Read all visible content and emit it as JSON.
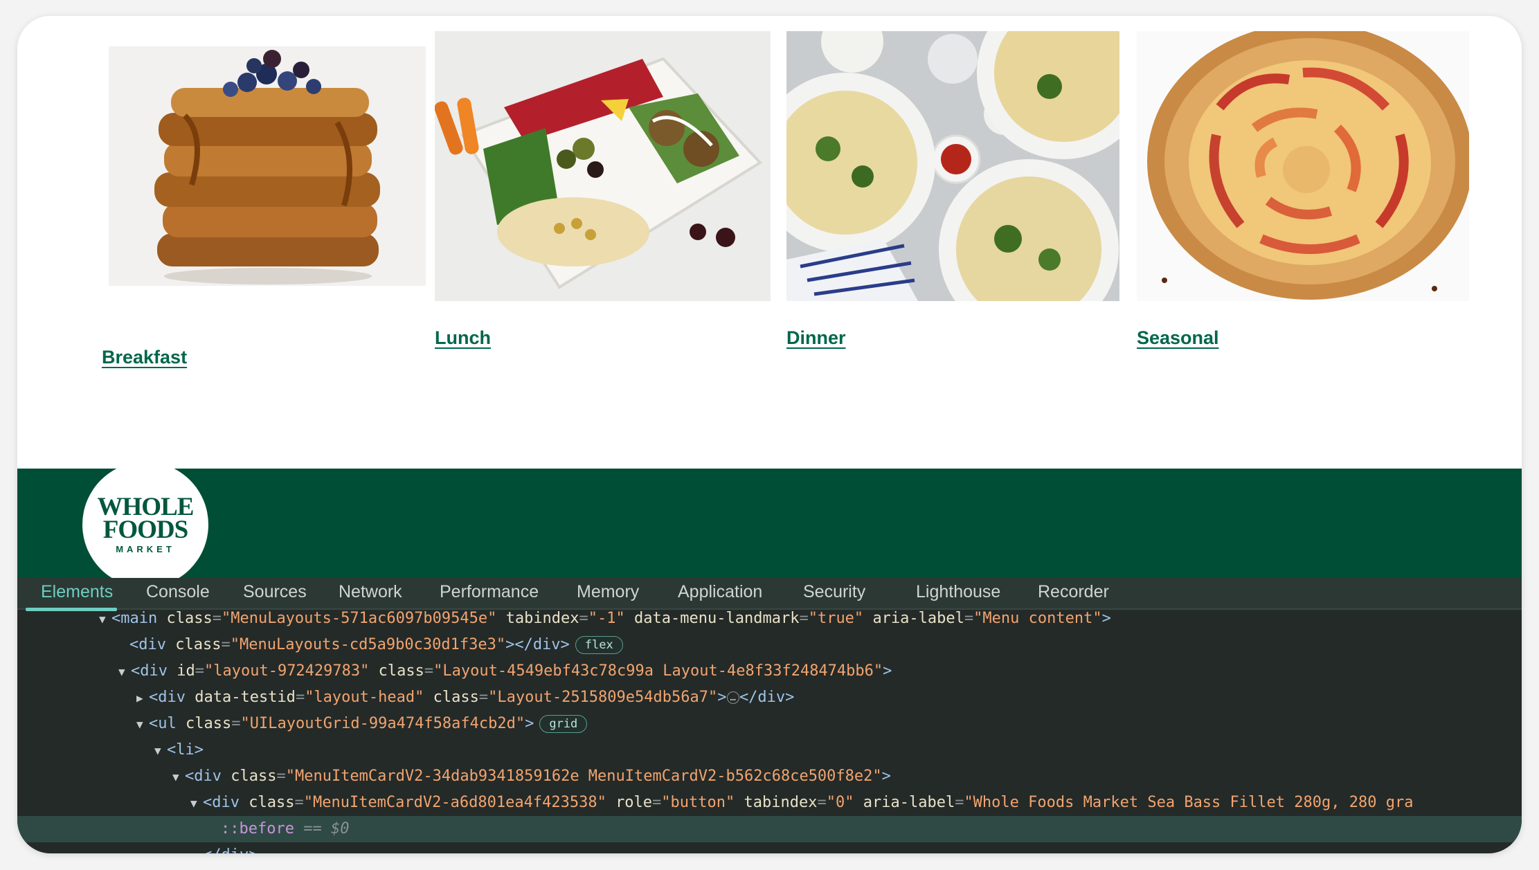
{
  "menu_cards": [
    {
      "label": "Breakfast",
      "image": "french-toast-stack"
    },
    {
      "label": "Lunch",
      "image": "falafel-lunch-tray"
    },
    {
      "label": "Dinner",
      "image": "orecchiette-pasta-bowls"
    },
    {
      "label": "Seasonal",
      "image": "apple-galette"
    }
  ],
  "logo": {
    "line1": "WHOLE",
    "line2": "FOODS",
    "line3": "MARKET"
  },
  "devtools": {
    "tabs": [
      "Elements",
      "Console",
      "Sources",
      "Network",
      "Performance",
      "Memory",
      "Application",
      "Security",
      "Lighthouse",
      "Recorder"
    ],
    "active_tab": "Elements",
    "dom": {
      "l1_tag_open": "<main",
      "l1_a1": "class",
      "l1_v1": "\"MenuLayouts-571ac6097b09545e\"",
      "l1_a2": "tabindex",
      "l1_v2": "\"-1\"",
      "l1_a3": "data-menu-landmark",
      "l1_v3": "\"true\"",
      "l1_a4": "aria-label",
      "l1_v4": "\"Menu content\"",
      "l2_tag_open": "<div",
      "l2_a1": "class",
      "l2_v1": "\"MenuLayouts-cd5a9b0c30d1f3e3\"",
      "l2_close": "></div>",
      "l2_badge": "flex",
      "l3_tag_open": "<div",
      "l3_a1": "id",
      "l3_v1": "\"layout-972429783\"",
      "l3_a2": "class",
      "l3_v2": "\"Layout-4549ebf43c78c99a Layout-4e8f33f248474bb6\"",
      "l4_tag_open": "<div",
      "l4_a1": "data-testid",
      "l4_v1": "\"layout-head\"",
      "l4_a2": "class",
      "l4_v2": "\"Layout-2515809e54db56a7\"",
      "l4_ellipsis": "…",
      "l4_close": "</div>",
      "l5_tag_open": "<ul",
      "l5_a1": "class",
      "l5_v1": "\"UILayoutGrid-99a474f58af4cb2d\"",
      "l5_badge": "grid",
      "l6_tag": "<li>",
      "l7_tag_open": "<div",
      "l7_a1": "class",
      "l7_v1": "\"MenuItemCardV2-34dab9341859162e MenuItemCardV2-b562c68ce500f8e2\"",
      "l8_tag_open": "<div",
      "l8_a1": "class",
      "l8_v1": "\"MenuItemCardV2-a6d801ea4f423538\"",
      "l8_a2": "role",
      "l8_v2": "\"button\"",
      "l8_a3": "tabindex",
      "l8_v3": "\"0\"",
      "l8_a4": "aria-label",
      "l8_v4": "\"Whole Foods Market Sea Bass Fillet 280g, 280 gra",
      "l9_pseudo": "::before",
      "l9_eq": "== $0",
      "l10_close": "</div>"
    }
  },
  "colors": {
    "accent": "#00674b",
    "brand_bar": "#004e36",
    "devtools_bg": "#242a28",
    "active_tab": "#6ecfc1"
  }
}
